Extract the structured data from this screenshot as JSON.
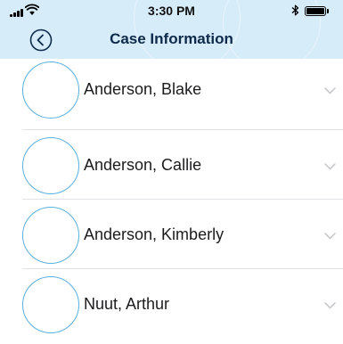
{
  "status_bar": {
    "time": "3:30 PM",
    "signal_icon": "signal-bars-icon",
    "wifi_icon": "wifi-icon",
    "bluetooth_icon": "bluetooth-icon",
    "battery_icon": "battery-icon",
    "battery_level": 1.0
  },
  "nav": {
    "title": "Case Information",
    "back_icon": "chevron-left-circle-icon"
  },
  "contacts": [
    {
      "name": "Anderson, Blake"
    },
    {
      "name": "Anderson, Callie"
    },
    {
      "name": "Anderson, Kimberly"
    },
    {
      "name": "Nuut, Arthur"
    }
  ],
  "colors": {
    "header_bg": "#d7ecf9",
    "avatar_border": "#5ab0de",
    "title_text": "#0d2a4a",
    "chevron": "#c4c4c8"
  }
}
